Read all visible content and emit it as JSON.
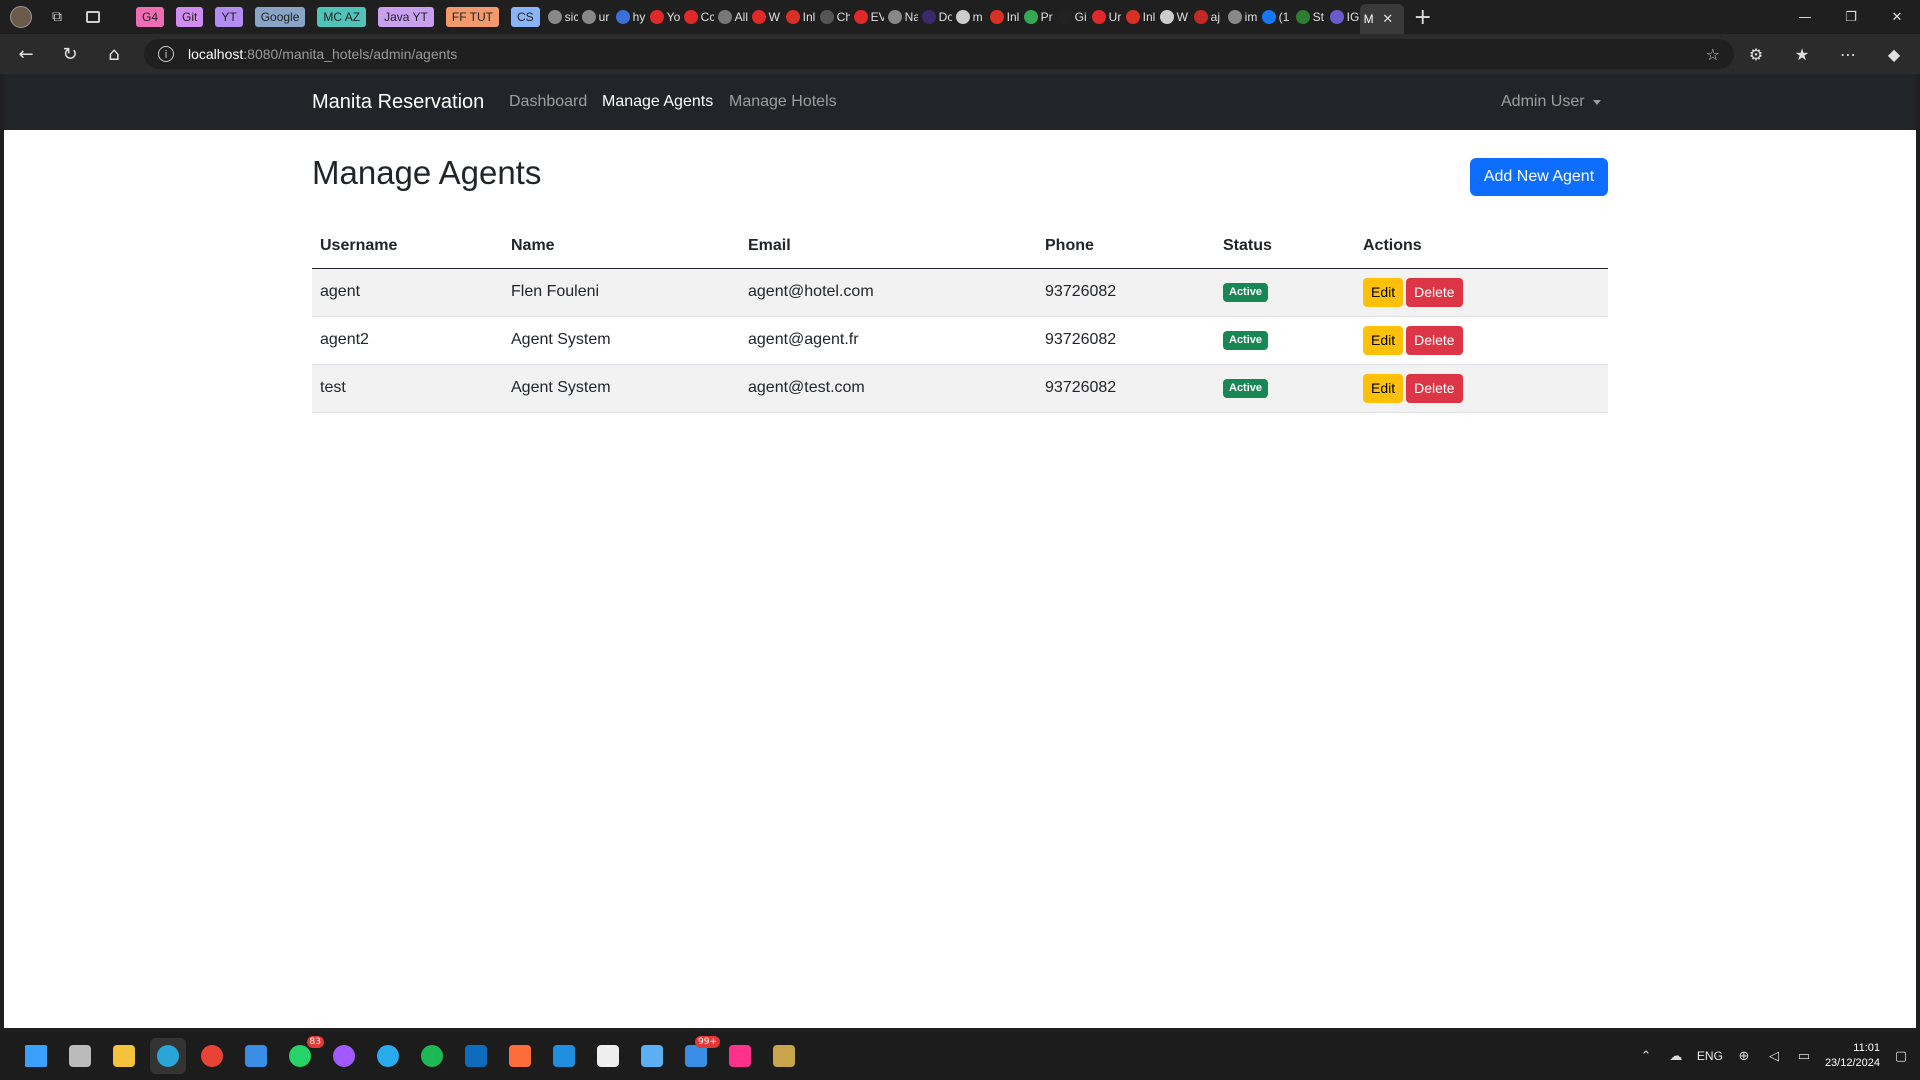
{
  "browser": {
    "pinned_tabs": [
      {
        "label": "G4",
        "color": "#f06db5"
      },
      {
        "label": "Git",
        "color": "#d18cf0"
      },
      {
        "label": "YT",
        "color": "#b28cf0"
      },
      {
        "label": "Google",
        "color": "#8aa4c8"
      },
      {
        "label": "MC AZ",
        "color": "#4fc3b8"
      },
      {
        "label": "Java YT",
        "color": "#c9a0f0"
      },
      {
        "label": "FF TUT",
        "color": "#f29a6b"
      },
      {
        "label": "CS",
        "color": "#8ab4f8"
      }
    ],
    "mini_tabs": [
      {
        "title": "sic",
        "color": "#888888"
      },
      {
        "title": "ur",
        "color": "#888888"
      },
      {
        "title": "hy",
        "color": "#3b6fd9"
      },
      {
        "title": "Yo",
        "color": "#e02828"
      },
      {
        "title": "Cc",
        "color": "#e02828"
      },
      {
        "title": "All",
        "color": "#777777"
      },
      {
        "title": "W",
        "color": "#e02828"
      },
      {
        "title": "Inl",
        "color": "#d93025"
      },
      {
        "title": "Ch",
        "color": "#555555"
      },
      {
        "title": "EV",
        "color": "#e02828"
      },
      {
        "title": "Na",
        "color": "#888888"
      },
      {
        "title": "Do",
        "color": "#3b2a6b"
      },
      {
        "title": "m",
        "color": "#cccccc"
      },
      {
        "title": "Inl",
        "color": "#d93025"
      },
      {
        "title": "Pr",
        "color": "#34a853"
      },
      {
        "title": "Gi",
        "color": "#222222"
      },
      {
        "title": "Ur",
        "color": "#e02828"
      },
      {
        "title": "Inl",
        "color": "#d93025"
      },
      {
        "title": "W",
        "color": "#cccccc"
      },
      {
        "title": "aj",
        "color": "#c62828"
      },
      {
        "title": "im",
        "color": "#888888"
      },
      {
        "title": "(1",
        "color": "#1877f2"
      },
      {
        "title": "St",
        "color": "#2e7d32"
      },
      {
        "title": "IG",
        "color": "#6a5acd"
      }
    ],
    "active_tab": {
      "title": "M",
      "icon": "close-icon"
    },
    "address": {
      "host": "localhost",
      "path": ":8080/manita_hotels/admin/agents"
    }
  },
  "navbar": {
    "brand": "Manita Reservation",
    "links": [
      "Dashboard",
      "Manage Agents",
      "Manage Hotels"
    ],
    "active": "Manage Agents",
    "user": "Admin User"
  },
  "page": {
    "title": "Manage Agents",
    "add_button": "Add New Agent"
  },
  "table": {
    "headers": [
      "Username",
      "Name",
      "Email",
      "Phone",
      "Status",
      "Actions"
    ],
    "rows": [
      {
        "username": "agent",
        "name": "Flen Fouleni",
        "email": "agent@hotel.com",
        "phone": "93726082",
        "status": "Active",
        "edit": "Edit",
        "delete": "Delete"
      },
      {
        "username": "agent2",
        "name": "Agent System",
        "email": "agent@agent.fr",
        "phone": "93726082",
        "status": "Active",
        "edit": "Edit",
        "delete": "Delete"
      },
      {
        "username": "test",
        "name": "Agent System",
        "email": "agent@test.com",
        "phone": "93726082",
        "status": "Active",
        "edit": "Edit",
        "delete": "Delete"
      }
    ]
  },
  "taskbar": {
    "apps": [
      {
        "name": "start",
        "color": "#3aa0ff"
      },
      {
        "name": "task-view",
        "color": "#bbbbbb"
      },
      {
        "name": "file-explorer",
        "color": "#f4c23d"
      },
      {
        "name": "edge",
        "color": "#2aa6d8",
        "active": true
      },
      {
        "name": "chrome",
        "color": "#ea4335"
      },
      {
        "name": "store",
        "color": "#3a8ee6"
      },
      {
        "name": "whatsapp",
        "color": "#25d366",
        "badge": "83"
      },
      {
        "name": "messenger",
        "color": "#a259ff"
      },
      {
        "name": "telegram",
        "color": "#2aabee"
      },
      {
        "name": "spotify",
        "color": "#1db954"
      },
      {
        "name": "outlook",
        "color": "#0f6cbd"
      },
      {
        "name": "paint",
        "color": "#ff6d3a"
      },
      {
        "name": "trello",
        "color": "#1f8fe0"
      },
      {
        "name": "notion",
        "color": "#eeeeee"
      },
      {
        "name": "notepad",
        "color": "#5ab0f0"
      },
      {
        "name": "mail",
        "color": "#3a8ee6",
        "badge": "99+"
      },
      {
        "name": "intellij",
        "color": "#ff318c"
      },
      {
        "name": "league",
        "color": "#c8a44d"
      }
    ],
    "tray": {
      "language": "ENG",
      "time": "11:01",
      "date": "23/12/2024"
    }
  }
}
